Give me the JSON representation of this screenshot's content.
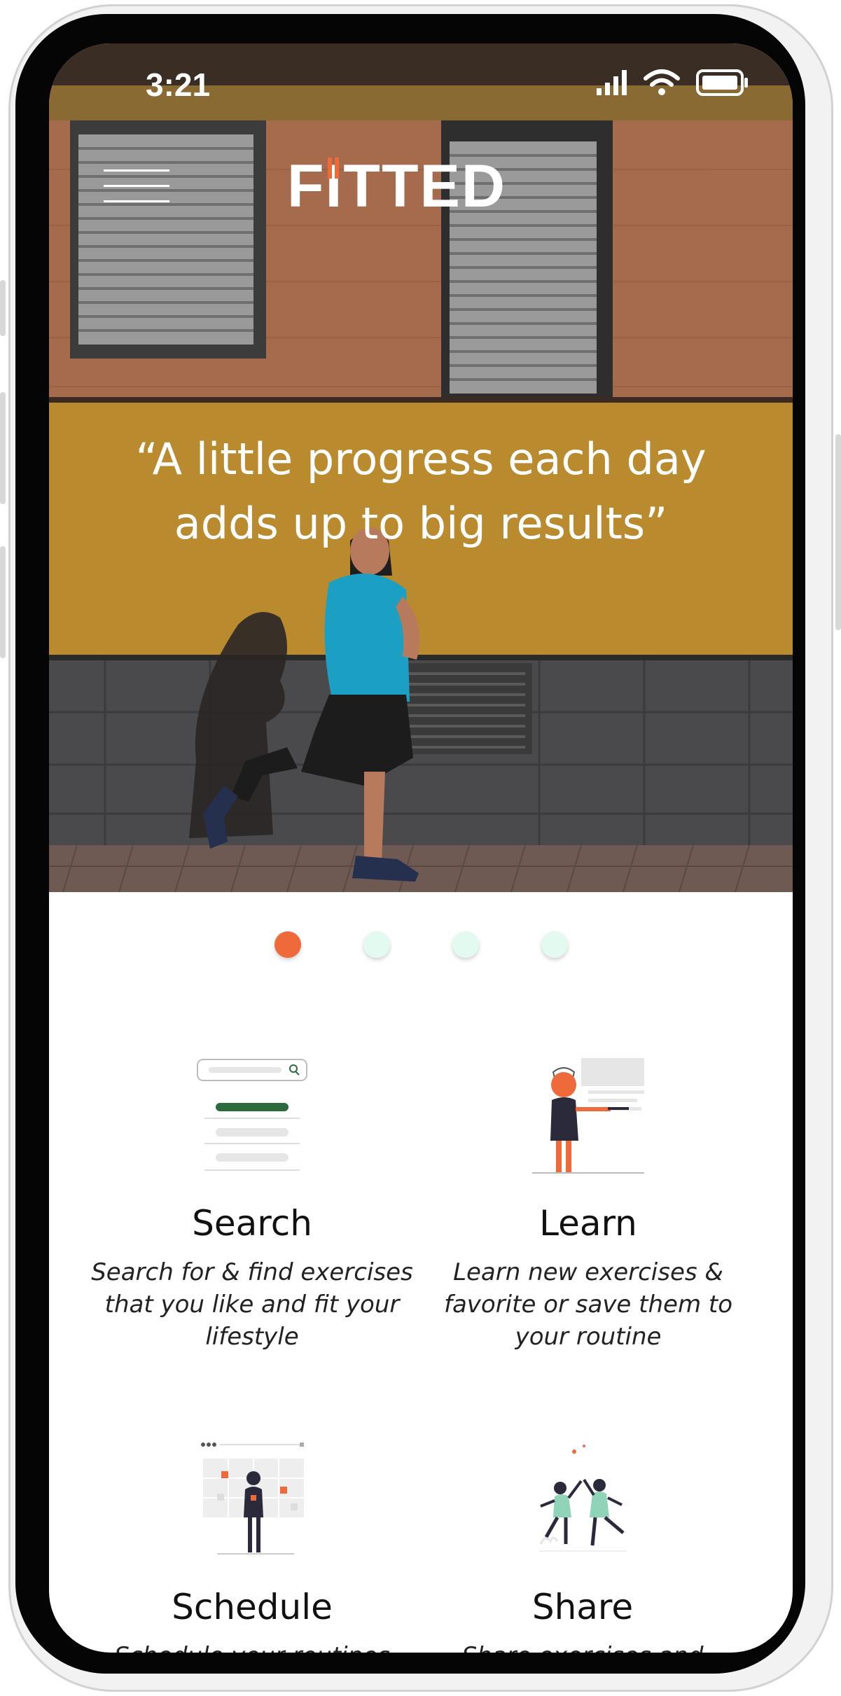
{
  "status_bar": {
    "time": "3:21"
  },
  "header": {
    "app_name": "FITTED"
  },
  "hero": {
    "quote": "“A little progress each day adds up to big results”"
  },
  "carousel": {
    "active_index": 0,
    "count": 4,
    "active_color": "#ee6a3a",
    "inactive_color": "#e3faf0"
  },
  "features": [
    {
      "title": "Search",
      "description": "Search for & find exercises that you like and fit your lifestyle"
    },
    {
      "title": "Learn",
      "description": "Learn new exercises & favorite or save them to your routine"
    },
    {
      "title": "Schedule",
      "description": "Schedule your routines"
    },
    {
      "title": "Share",
      "description": "Share exercises and"
    }
  ],
  "colors": {
    "accent": "#ee6a3a",
    "green": "#2d6a3e"
  }
}
